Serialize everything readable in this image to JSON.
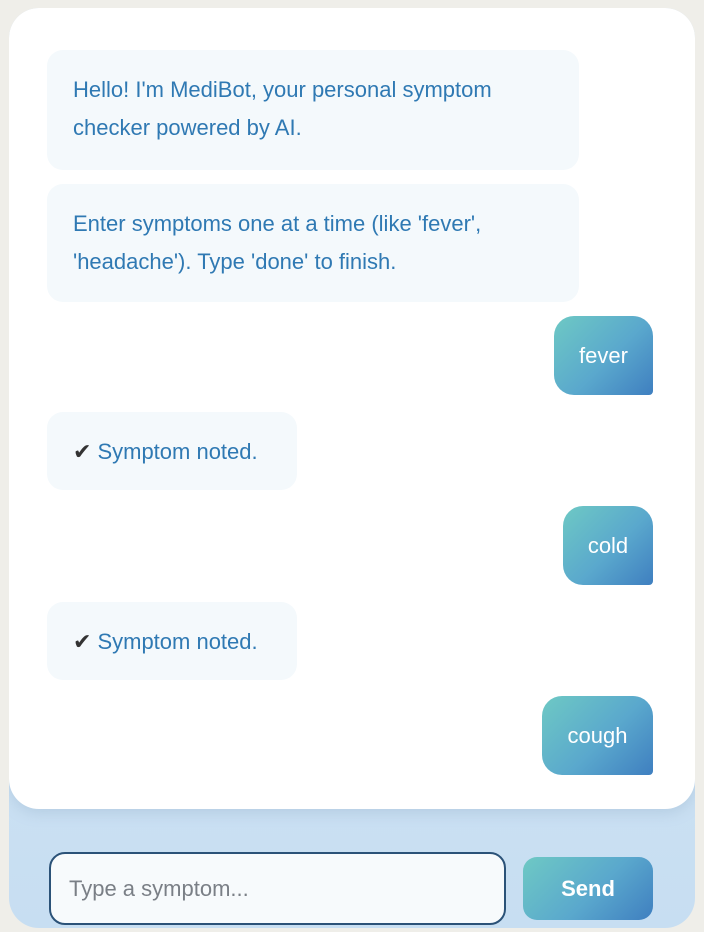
{
  "messages": [
    {
      "role": "bot",
      "line1": "Hello! I'm MediBot, your personal symptom",
      "line2": "checker powered by AI."
    },
    {
      "role": "bot",
      "line1": "Enter symptoms one at a time (like 'fever',",
      "line2": "'headache'). Type 'done' to finish."
    },
    {
      "role": "user",
      "text": "fever"
    },
    {
      "role": "bot",
      "check": "✔",
      "text": "Symptom noted."
    },
    {
      "role": "user",
      "text": "cold"
    },
    {
      "role": "bot",
      "check": "✔",
      "text": "Symptom noted."
    },
    {
      "role": "user",
      "text": "cough"
    }
  ],
  "input": {
    "placeholder": "Type a symptom...",
    "value": ""
  },
  "send_label": "Send",
  "colors": {
    "bot_text": "#2f79b3",
    "user_bubble_start": "#6ec9c4",
    "user_bubble_end": "#3f7fc0",
    "input_border": "#2b5278"
  }
}
